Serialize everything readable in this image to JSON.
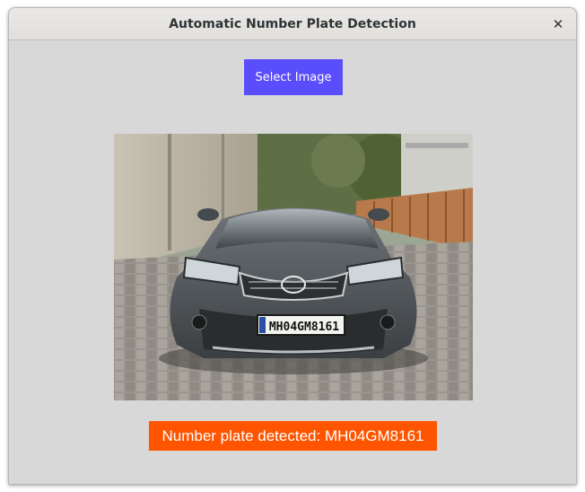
{
  "window": {
    "title": "Automatic Number Plate Detection",
    "close_icon": "close-icon"
  },
  "main": {
    "select_button_label": "Select Image",
    "image": {
      "subject": "car-photo",
      "plate_text": "MH04GM8161"
    },
    "result_text": "Number plate detected: MH04GM8161"
  },
  "colors": {
    "window_bg": "#d8d8d8",
    "button_bg": "#5a4dfb",
    "result_bg": "#ff5500",
    "text_light": "#ffffff"
  }
}
